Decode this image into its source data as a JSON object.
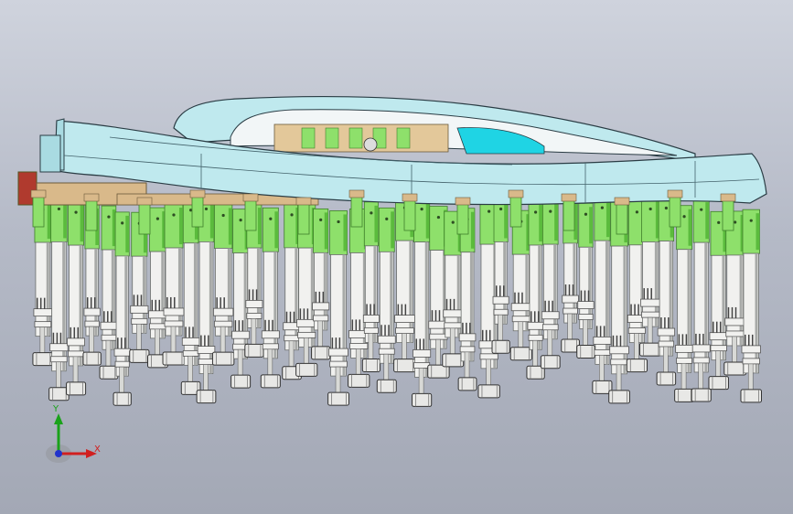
{
  "viewport": {
    "background_top": "#cfd3dd",
    "background_bottom": "#a3a8b5"
  },
  "model": {
    "colors": {
      "body_fill": "#bfe9ee",
      "body_stroke": "#2a3c44",
      "window_fill": "#f2f6f7",
      "interior_cyan": "#1fd4e4",
      "interior_tan": "#e3c89a",
      "clamp_green": "#8ee06b",
      "clamp_green_dark": "#5bbb3d",
      "rod_white": "#f1f1ef",
      "rod_shadow": "#a7a9a7",
      "nut_fill": "#e8e8e6",
      "bracket_tan": "#d9b98a",
      "accent_red": "#b03a2e"
    },
    "support_columns": 44
  },
  "triad": {
    "y_label": "Y",
    "x_label": "X",
    "colors": {
      "y": "#1aa21a",
      "x": "#d11f1f",
      "z": "#2233cc"
    }
  }
}
